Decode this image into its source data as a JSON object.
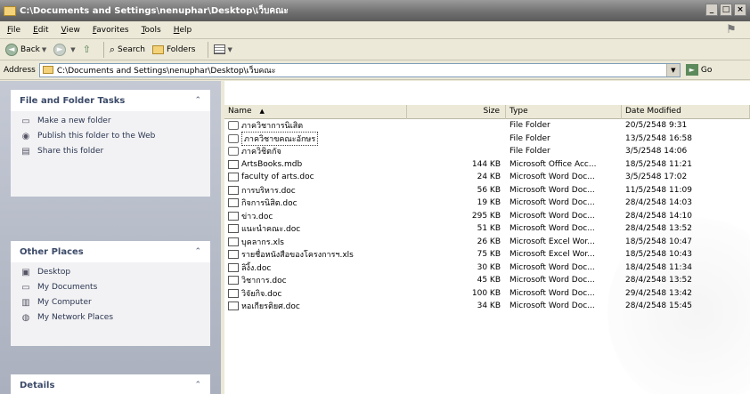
{
  "window": {
    "title": "C:\\Documents and Settings\\nenuphar\\Desktop\\เว็บคณะ",
    "controls": [
      "_",
      "□",
      "×"
    ]
  },
  "menu": [
    "File",
    "Edit",
    "View",
    "Favorites",
    "Tools",
    "Help"
  ],
  "toolbar": {
    "back": "Back",
    "search": "Search",
    "folders": "Folders"
  },
  "address": {
    "label": "Address",
    "value": "C:\\Documents and Settings\\nenuphar\\Desktop\\เว็บคณะ",
    "go": "Go"
  },
  "panels": {
    "file_tasks": {
      "title": "File and Folder Tasks",
      "items": [
        "Make a new folder",
        "Publish this folder to the Web",
        "Share this folder"
      ]
    },
    "other_places": {
      "title": "Other Places",
      "items": [
        "Desktop",
        "My Documents",
        "My Computer",
        "My Network Places"
      ]
    },
    "details": {
      "title": "Details"
    }
  },
  "columns": [
    "Name",
    "Size",
    "Type",
    "Date Modified"
  ],
  "files": [
    {
      "name": "ภาควิชาการนิเสิต",
      "size": "",
      "type": "File Folder",
      "date": "20/5/2548 9:31",
      "icon": "folder"
    },
    {
      "name": "ภาควิชาขคณะอักษร",
      "size": "",
      "type": "File Folder",
      "date": "13/5/2548 16:58",
      "icon": "folder"
    },
    {
      "name": "ภาควิชิตกัจ",
      "size": "",
      "type": "File Folder",
      "date": "3/5/2548 14:06",
      "icon": "folder"
    },
    {
      "name": "ArtsBooks.mdb",
      "size": "144 KB",
      "type": "Microsoft Office Acc...",
      "date": "18/5/2548 11:21",
      "icon": "doc"
    },
    {
      "name": "faculty of arts.doc",
      "size": "24 KB",
      "type": "Microsoft Word Doc...",
      "date": "3/5/2548 17:02",
      "icon": "doc"
    },
    {
      "name": "การบริหาร.doc",
      "size": "56 KB",
      "type": "Microsoft Word Doc...",
      "date": "11/5/2548 11:09",
      "icon": "doc"
    },
    {
      "name": "กิจการนิสิต.doc",
      "size": "19 KB",
      "type": "Microsoft Word Doc...",
      "date": "28/4/2548 14:03",
      "icon": "doc"
    },
    {
      "name": "ข่าว.doc",
      "size": "295 KB",
      "type": "Microsoft Word Doc...",
      "date": "28/4/2548 14:10",
      "icon": "doc"
    },
    {
      "name": "แนะนำคณะ.doc",
      "size": "51 KB",
      "type": "Microsoft Word Doc...",
      "date": "28/4/2548 13:52",
      "icon": "doc"
    },
    {
      "name": "บุคลากร.xls",
      "size": "26 KB",
      "type": "Microsoft Excel Wor...",
      "date": "18/5/2548 10:47",
      "icon": "doc"
    },
    {
      "name": "รายชื่อหนังสือของโครงการฯ.xls",
      "size": "75 KB",
      "type": "Microsoft Excel Wor...",
      "date": "18/5/2548 10:43",
      "icon": "doc"
    },
    {
      "name": "ลิงิ้ง.doc",
      "size": "30 KB",
      "type": "Microsoft Word Doc...",
      "date": "18/4/2548 11:34",
      "icon": "doc"
    },
    {
      "name": "วิชาการ.doc",
      "size": "45 KB",
      "type": "Microsoft Word Doc...",
      "date": "28/4/2548 13:52",
      "icon": "doc"
    },
    {
      "name": "วิจัยกิจ.doc",
      "size": "100 KB",
      "type": "Microsoft Word Doc...",
      "date": "29/4/2548 13:42",
      "icon": "doc"
    },
    {
      "name": "หอเกียรติยศ.doc",
      "size": "34 KB",
      "type": "Microsoft Word Doc...",
      "date": "28/4/2548 15:45",
      "icon": "doc"
    }
  ]
}
